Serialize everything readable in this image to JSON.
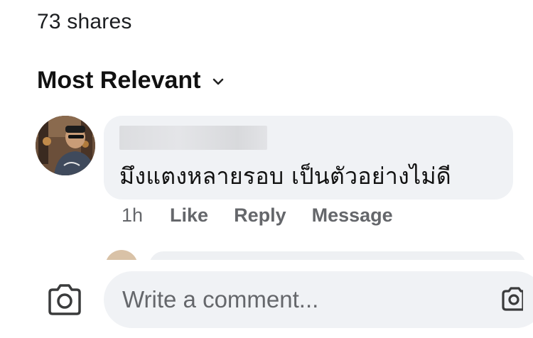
{
  "post": {
    "shares": "73 shares"
  },
  "comments_filter": {
    "label": "Most Relevant",
    "icon": "chevron-down-icon"
  },
  "comment": {
    "text": "มึงแตงหลายรอบ  เป็นตัวอย่างไม่ดี",
    "time": "1h",
    "actions": {
      "like": "Like",
      "reply": "Reply",
      "message": "Message"
    }
  },
  "composer": {
    "placeholder": "Write a comment...",
    "camera_icon": "camera-icon",
    "trailing_icon": "camera-icon"
  },
  "colors": {
    "bubble": "#f0f2f5",
    "secondary_text": "#65676b",
    "primary_text": "#1c1e21"
  }
}
